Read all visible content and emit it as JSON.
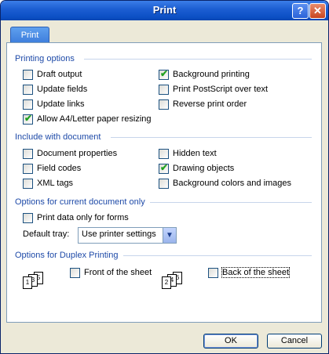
{
  "window": {
    "title": "Print",
    "help_glyph": "?",
    "close_glyph": "✕"
  },
  "tabs": [
    {
      "label": "Print",
      "active": true
    }
  ],
  "printing_options": {
    "header": "Printing options",
    "items": [
      {
        "label": "Draft output",
        "checked": false
      },
      {
        "label": "Update fields",
        "checked": false
      },
      {
        "label": "Update links",
        "checked": false
      },
      {
        "label": "Allow A4/Letter paper resizing",
        "checked": true
      },
      {
        "label": "Background printing",
        "checked": true
      },
      {
        "label": "Print PostScript over text",
        "checked": false
      },
      {
        "label": "Reverse print order",
        "checked": false
      }
    ]
  },
  "include_with_document": {
    "header": "Include with document",
    "items": [
      {
        "label": "Document properties",
        "checked": false
      },
      {
        "label": "Field codes",
        "checked": false
      },
      {
        "label": "XML tags",
        "checked": false
      },
      {
        "label": "Hidden text",
        "checked": false
      },
      {
        "label": "Drawing objects",
        "checked": true
      },
      {
        "label": "Background colors and images",
        "checked": false
      }
    ]
  },
  "current_document": {
    "header": "Options for current document only",
    "print_data_only": {
      "label": "Print data only for forms",
      "checked": false
    },
    "default_tray_label": "Default tray:",
    "default_tray_value": "Use printer settings"
  },
  "duplex": {
    "header": "Options for Duplex Printing",
    "front": {
      "label": "Front of the sheet",
      "checked": false,
      "icon_pages": [
        "1",
        "3",
        "5"
      ]
    },
    "back": {
      "label": "Back of the sheet",
      "checked": false,
      "icon_pages": [
        "2",
        "4",
        "6"
      ]
    }
  },
  "buttons": {
    "ok": "OK",
    "cancel": "Cancel"
  },
  "check_glyph": "✔",
  "dropdown_glyph": "▼"
}
